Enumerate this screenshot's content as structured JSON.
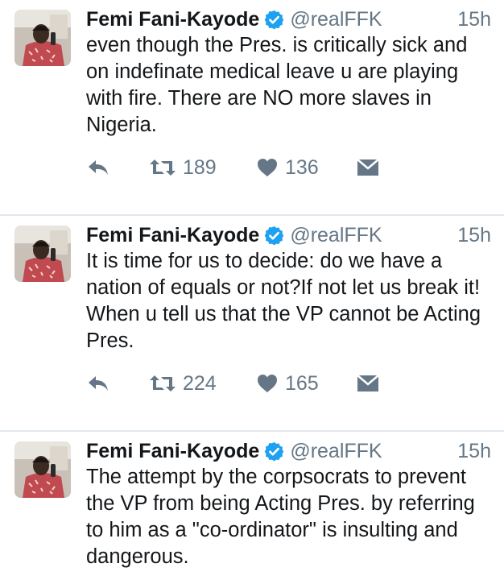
{
  "colors": {
    "text": "#14171a",
    "secondary": "#657786",
    "verified_badge": "#1da1f2",
    "divider": "#e1e8ed"
  },
  "tweets": [
    {
      "author_name": "Femi Fani-Kayode",
      "handle": "@realFFK",
      "time": "15h",
      "text": "even though the Pres. is critically sick and on indefinate medical leave u are playing with fire. There are NO more slaves in Nigeria.",
      "retweets": "189",
      "likes": "136"
    },
    {
      "author_name": "Femi Fani-Kayode",
      "handle": "@realFFK",
      "time": "15h",
      "text": "It is time for us to decide: do we have a nation of equals or not?If not let us break it! When u tell us that the VP cannot be Acting Pres.",
      "retweets": "224",
      "likes": "165"
    },
    {
      "author_name": "Femi Fani-Kayode",
      "handle": "@realFFK",
      "time": "15h",
      "text": "The attempt by the corpsocrats to prevent the VP from being Acting Pres. by referring to him as a \"co-ordinator\" is insulting and dangerous."
    }
  ],
  "icons": {
    "avatar": "profile-photo",
    "verified": "verified-badge-icon",
    "reply": "reply-arrow-icon",
    "retweet": "retweet-icon",
    "like": "heart-icon",
    "dm": "envelope-icon"
  }
}
